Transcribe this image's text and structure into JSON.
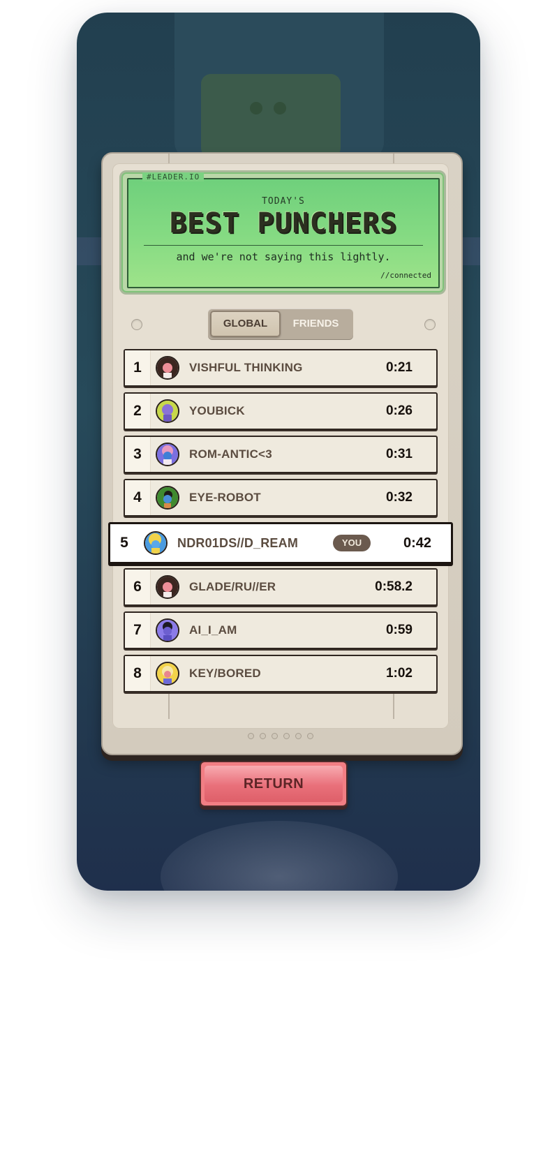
{
  "screen": {
    "tag": "#LEADER.IO",
    "subtitle": "TODAY'S",
    "title": "BEST PUNCHERS",
    "tagline": "and we're not saying this lightly.",
    "status": "//connected"
  },
  "tabs": [
    {
      "label": "GLOBAL",
      "active": true
    },
    {
      "label": "FRIENDS",
      "active": false
    }
  ],
  "leaderboard": [
    {
      "rank": "1",
      "name": "VISHFUL THINKING",
      "time": "0:21",
      "avatar": "avatar-dark-hair-pink-face"
    },
    {
      "rank": "2",
      "name": "YOUBICK",
      "time": "0:26",
      "avatar": "avatar-purple-lime"
    },
    {
      "rank": "3",
      "name": "ROM-ANTIC<3",
      "time": "0:31",
      "avatar": "avatar-blue-pink-hair"
    },
    {
      "rank": "4",
      "name": "EYE-ROBOT",
      "time": "0:32",
      "avatar": "avatar-green-blue-face"
    },
    {
      "rank": "5",
      "name": "NDR01DS//D_REAM",
      "time": "0:42",
      "avatar": "avatar-blue-yellow-hair",
      "is_current_user": true,
      "badge": "YOU"
    },
    {
      "rank": "6",
      "name": "GLADE/RU//ER",
      "time": "0:58.2",
      "avatar": "avatar-dark-hair-pink-face"
    },
    {
      "rank": "7",
      "name": "AI_I_AM",
      "time": "0:59",
      "avatar": "avatar-purple-face"
    },
    {
      "rank": "8",
      "name": "KEY/BORED",
      "time": "1:02",
      "avatar": "avatar-yellow-hair-pink-face"
    }
  ],
  "pagination": {
    "pages": 6
  },
  "actions": {
    "return_label": "RETURN"
  },
  "colors": {
    "background": "#274a5a",
    "lcd": "#86db83",
    "cabinet": "#d9d2c5",
    "return_button": "#f27e84",
    "ink": "#17110d"
  }
}
